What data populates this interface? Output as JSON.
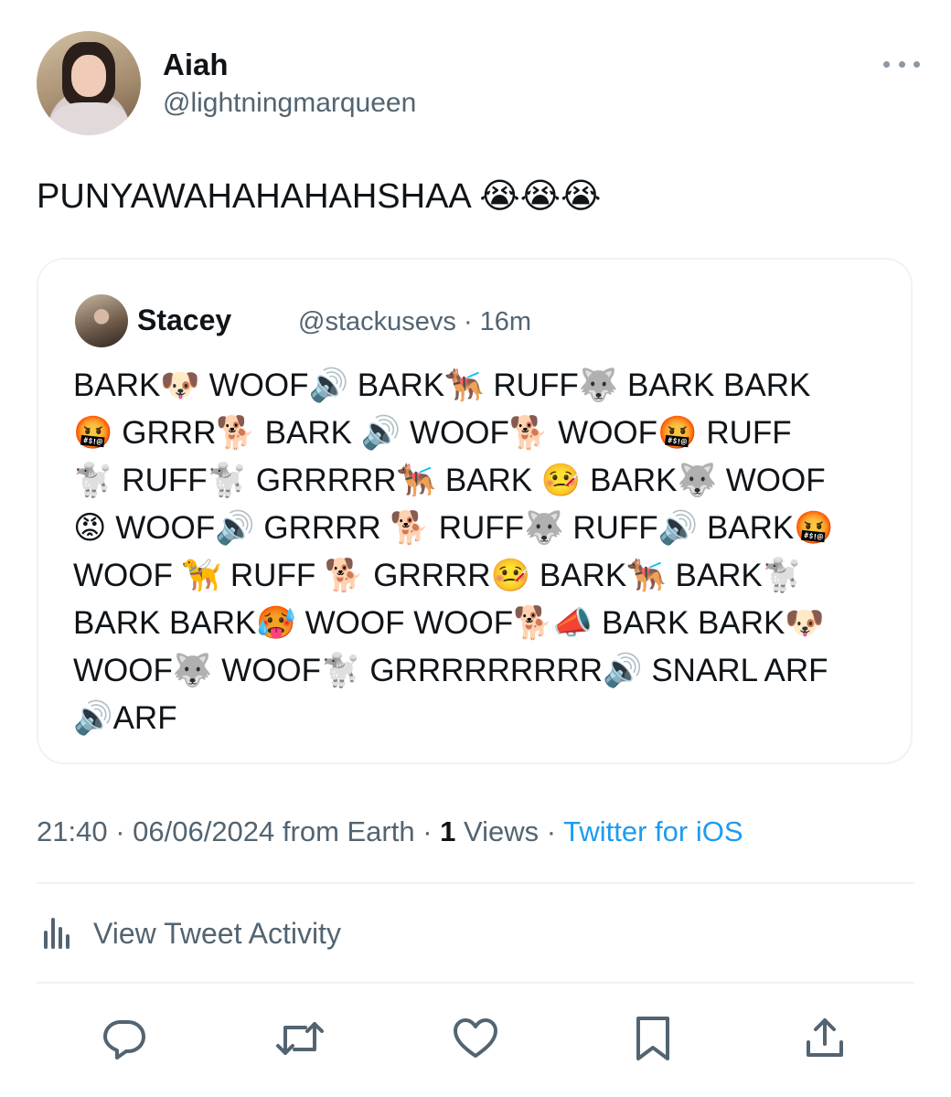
{
  "author": {
    "name": "Aiah",
    "handle": "@lightningmarqueen"
  },
  "tweet": {
    "text": "PUNYAWAHAHAHAHSHAA 😭😭😭"
  },
  "quoted": {
    "name": "Stacey",
    "handle_time": "@stackusevs · 16m",
    "lines": [
      "BARK🐶 WOOF🔊 BARK🐕‍🦺 RUFF🐺 BARK BARK",
      "🤬 GRRR🐕 BARK 🔊 WOOF🐕 WOOF🤬 RUFF",
      "🐩 RUFF🐩 GRRRRR🐕‍🦺 BARK 🤒 BARK🐺 WOOF",
      "😡 WOOF🔊 GRRRR 🐕 RUFF🐺 RUFF🔊 BARK🤬",
      "WOOF 🦮 RUFF 🐕 GRRRR🤒 BARK🐕‍🦺 BARK🐩",
      "BARK BARK🥵 WOOF WOOF🐕📣 BARK BARK🐶",
      "WOOF🐺 WOOF🐩 GRRRRRRRRR🔊 SNARL ARF",
      "🔊ARF"
    ]
  },
  "meta": {
    "datetime": "21:40 · 06/06/2024 from Earth · ",
    "views_count": "1",
    "views_label": " Views · ",
    "source": "Twitter for iOS"
  },
  "activity": {
    "label": "View Tweet Activity"
  },
  "colors": {
    "link": "#1d9bf0",
    "secondary_text": "#536471",
    "divider": "#eff3f4"
  },
  "icons": {
    "more": "more-horizontal-icon",
    "activity": "bar-chart-icon",
    "reply": "reply-icon",
    "retweet": "retweet-icon",
    "like": "heart-icon",
    "bookmark": "bookmark-icon",
    "share": "share-icon"
  }
}
